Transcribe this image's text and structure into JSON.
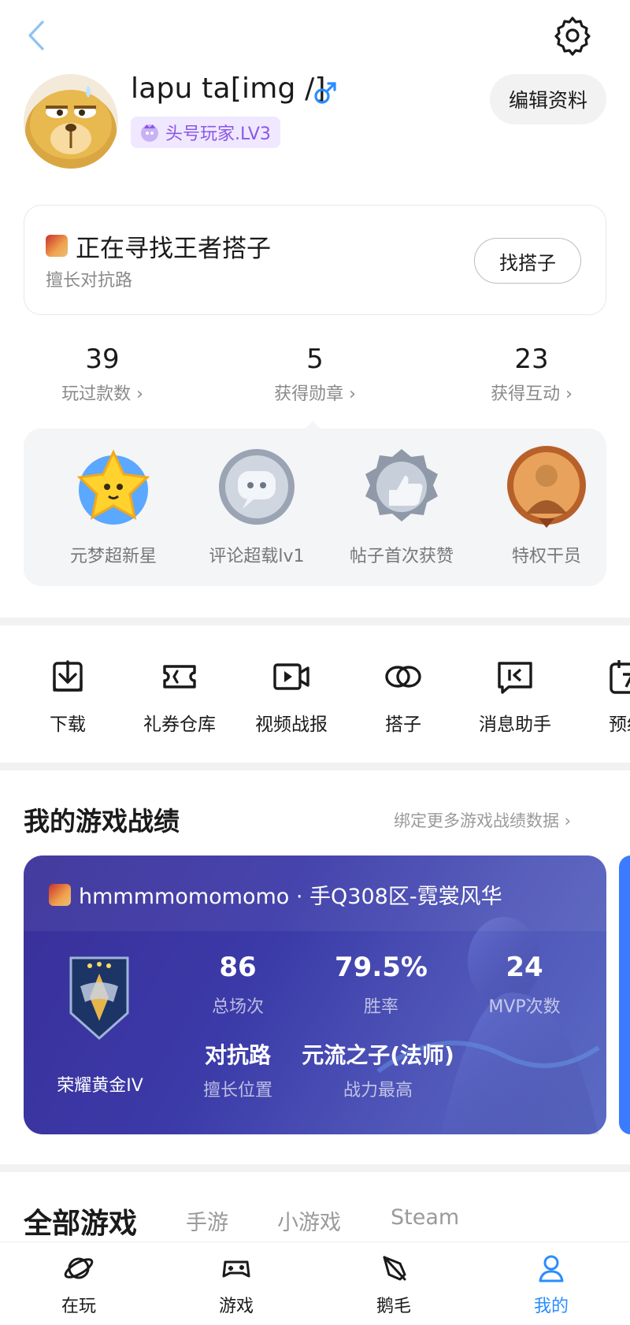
{
  "profile": {
    "username": "lapu ta[img /]",
    "gender_symbol": "♂",
    "level_badge": "头号玩家.LV3",
    "edit_button": "编辑资料"
  },
  "partner": {
    "title": "正在寻找王者搭子",
    "subtitle": "擅长对抗路",
    "button": "找搭子"
  },
  "stats": [
    {
      "value": "39",
      "label": "玩过款数 ›"
    },
    {
      "value": "5",
      "label": "获得勋章 ›"
    },
    {
      "value": "23",
      "label": "获得互动 ›"
    }
  ],
  "medals": [
    {
      "label": "元梦超新星",
      "icon": "star-medal-icon"
    },
    {
      "label": "评论超载lv1",
      "icon": "comment-medal-icon"
    },
    {
      "label": "帖子首次获赞",
      "icon": "thumbs-up-medal-icon"
    },
    {
      "label": "特权干员",
      "icon": "operator-medal-icon"
    }
  ],
  "shortcuts": [
    {
      "label": "下载",
      "icon": "download-icon"
    },
    {
      "label": "礼券仓库",
      "icon": "coupon-icon"
    },
    {
      "label": "视频战报",
      "icon": "video-report-icon"
    },
    {
      "label": "搭子",
      "icon": "partner-icon"
    },
    {
      "label": "消息助手",
      "icon": "message-assistant-icon"
    },
    {
      "label": "预约",
      "icon": "calendar-icon"
    }
  ],
  "record": {
    "section_title": "我的游戏战绩",
    "bind_link": "绑定更多游戏战绩数据  ›",
    "account": "hmmmmomomomo · 手Q308区-霓裳风华",
    "rank": "荣耀黄金IV",
    "stats": [
      {
        "value": "86",
        "label": "总场次"
      },
      {
        "value": "79.5%",
        "label": "胜率"
      },
      {
        "value": "24",
        "label": "MVP次数"
      },
      {
        "value": "对抗路",
        "label": "擅长位置"
      },
      {
        "value": "元流之子(法师)",
        "label": "战力最高"
      }
    ]
  },
  "tabs": {
    "main": "全部游戏",
    "others": [
      "手游",
      "小游戏",
      "Steam"
    ]
  },
  "bottom_nav": [
    {
      "label": "在玩",
      "icon": "planet-icon"
    },
    {
      "label": "游戏",
      "icon": "gamepad-icon"
    },
    {
      "label": "鹅毛",
      "icon": "feather-icon"
    },
    {
      "label": "我的",
      "icon": "profile-icon",
      "active": true
    }
  ],
  "colors": {
    "accent_blue": "#2a8cff",
    "level_purple": "#8a57e8",
    "record_card": "#3b3aa8"
  }
}
